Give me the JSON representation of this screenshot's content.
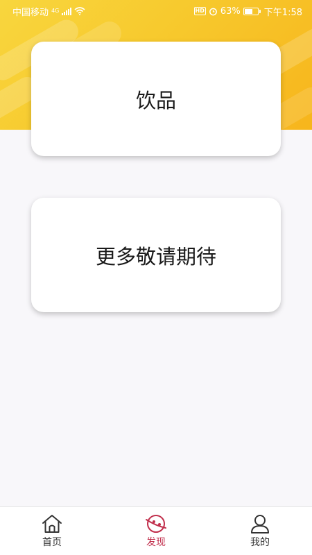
{
  "status_bar": {
    "carrier": "中国移动",
    "network": "4G",
    "battery_percent": "63%",
    "battery_level": 0.63,
    "time": "下午1:58",
    "hd_label": "HD"
  },
  "cards": [
    {
      "label": "饮品"
    },
    {
      "label": "更多敬请期待"
    }
  ],
  "nav": {
    "active": "discover",
    "items": [
      {
        "id": "home",
        "label": "首页",
        "icon": "home-icon"
      },
      {
        "id": "discover",
        "label": "发现",
        "icon": "planet-icon"
      },
      {
        "id": "mine",
        "label": "我的",
        "icon": "user-icon"
      }
    ]
  },
  "colors": {
    "header_yellow": "#f7c92d",
    "accent": "#c12f4c",
    "background": "#f8f7fa"
  }
}
